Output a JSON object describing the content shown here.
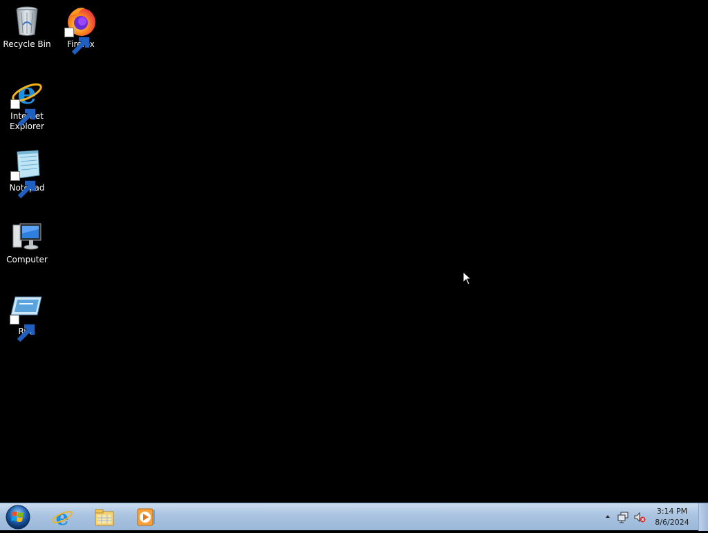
{
  "desktop": {
    "icons": [
      {
        "label": "Recycle Bin",
        "icon": "recycle-bin-icon"
      },
      {
        "label": "Firefox",
        "icon": "firefox-icon"
      },
      {
        "label": "Internet Explorer",
        "icon": "internet-explorer-icon"
      },
      {
        "label": "Notepad",
        "icon": "notepad-icon"
      },
      {
        "label": "Computer",
        "icon": "computer-icon"
      },
      {
        "label": "Run",
        "icon": "run-icon"
      }
    ]
  },
  "taskbar": {
    "pinned": [
      {
        "icon": "internet-explorer-icon"
      },
      {
        "icon": "file-explorer-icon"
      },
      {
        "icon": "media-player-icon"
      }
    ],
    "tray": {
      "time": "3:14 PM",
      "date": "8/6/2024"
    }
  },
  "colors": {
    "desktop_background": "#000000",
    "taskbar": "#a9c3e0"
  }
}
